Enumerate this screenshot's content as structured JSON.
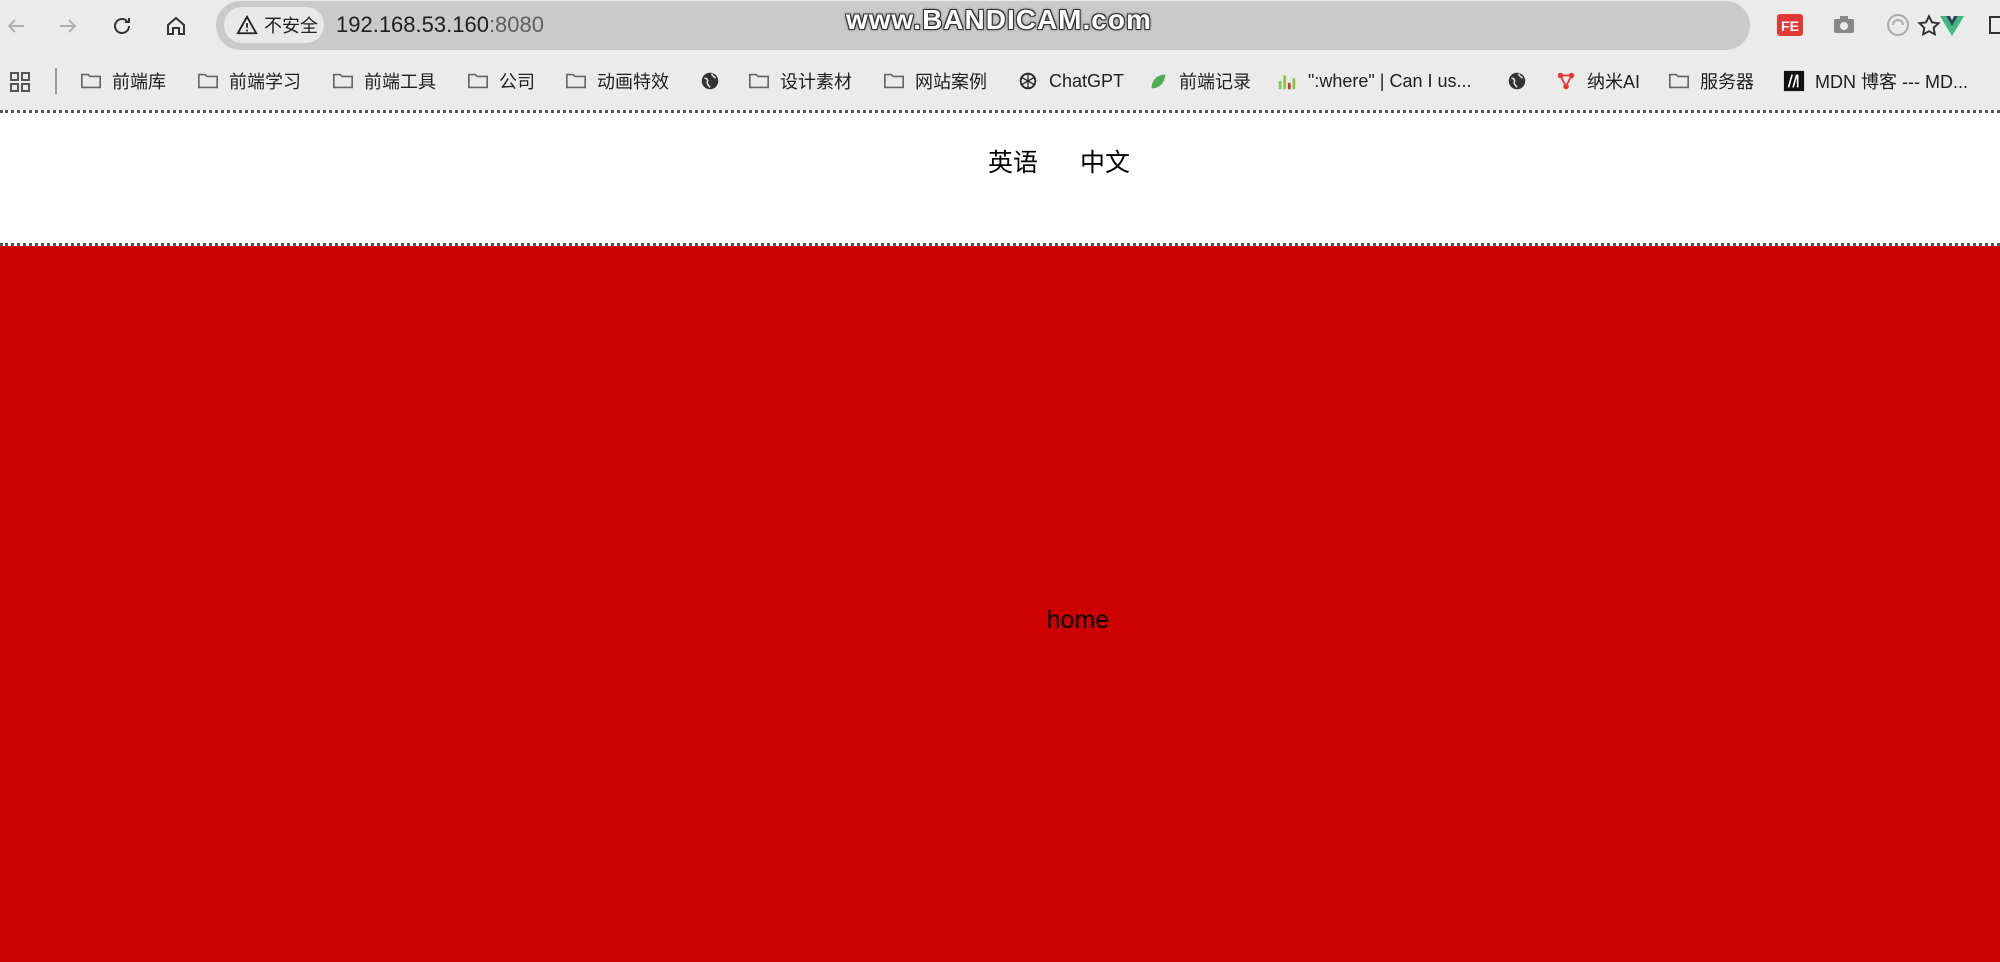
{
  "browser": {
    "security_label": "不安全",
    "url_host": "192.168.53.160",
    "url_port": ":8080",
    "watermark": "www.BANDICAM.com"
  },
  "bookmarks": [
    {
      "label": "前端库",
      "icon": "folder-icon"
    },
    {
      "label": "前端学习",
      "icon": "folder-icon"
    },
    {
      "label": "前端工具",
      "icon": "folder-icon"
    },
    {
      "label": "公司",
      "icon": "folder-icon"
    },
    {
      "label": "动画特效",
      "icon": "folder-icon"
    },
    {
      "label": "",
      "icon": "globe-icon"
    },
    {
      "label": "设计素材",
      "icon": "folder-icon"
    },
    {
      "label": "网站案例",
      "icon": "folder-icon"
    },
    {
      "label": "ChatGPT",
      "icon": "chatgpt-icon"
    },
    {
      "label": "前端记录",
      "icon": "leaf-icon"
    },
    {
      "label": "\":where\" | Can I us...",
      "icon": "caniuse-icon"
    },
    {
      "label": "",
      "icon": "globe-icon"
    },
    {
      "label": "纳米AI",
      "icon": "nami-icon"
    },
    {
      "label": "服务器",
      "icon": "folder-icon"
    },
    {
      "label": "MDN 博客 --- MD...",
      "icon": "mdn-icon"
    }
  ],
  "header": {
    "lang_en": "英语",
    "lang_zh": "中文"
  },
  "main": {
    "text": "home",
    "background": "#cc0000"
  },
  "colors": {
    "chrome_bg": "#ebebeb",
    "omnibox_bg": "#cacaca",
    "page_bg": "#ffffff"
  }
}
